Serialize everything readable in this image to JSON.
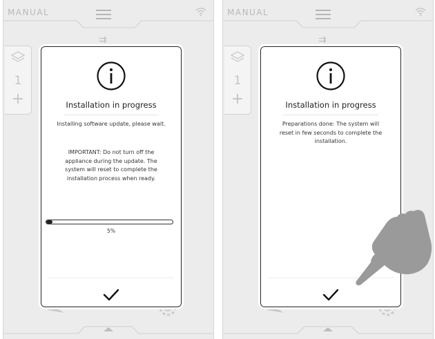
{
  "screens": [
    {
      "mode_label": "MANUAL",
      "side_panel": {
        "count": "1",
        "add": "+"
      },
      "dialog": {
        "title": "Installation in progress",
        "message": "Installing software update, please wait.",
        "important": "IMPORTANT: Do not turn off the appliance during the update. The system will reset to complete the installation process when ready.",
        "progress": {
          "percent": 5,
          "label": "5%"
        }
      }
    },
    {
      "mode_label": "MANUAL",
      "side_panel": {
        "count": "1",
        "add": "+"
      },
      "dialog": {
        "title": "Installation in progress",
        "message": "Preparations done: The system will reset in few seconds to complete the installation."
      }
    }
  ],
  "icons": {
    "menu": "hamburger-icon",
    "wifi": "wifi-icon",
    "info": "info-icon",
    "confirm": "checkmark-icon",
    "layers": "layers-icon",
    "pointer": "hand-pointer-icon"
  }
}
